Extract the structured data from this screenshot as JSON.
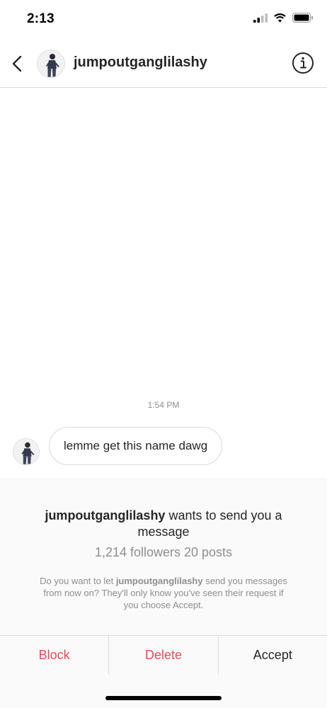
{
  "status_bar": {
    "time": "2:13",
    "icons": [
      "cellular-signal-icon",
      "wifi-icon",
      "battery-icon"
    ]
  },
  "nav": {
    "back_icon": "chevron-left-icon",
    "avatar": "profile-avatar",
    "username": "jumpoutganglilashy",
    "info_icon": "info-icon"
  },
  "chat": {
    "timestamp": "1:54 PM",
    "messages": [
      {
        "sender": "jumpoutganglilashy",
        "text": "lemme get this name dawg"
      }
    ]
  },
  "request": {
    "username": "jumpoutganglilashy",
    "title_suffix": " wants to send you a message",
    "stats": "1,214 followers 20 posts",
    "desc_prefix": "Do you want to let ",
    "desc_username": "jumpoutganglilashy",
    "desc_suffix": " send you messages from now on? They'll only know you've seen their request if you choose Accept."
  },
  "actions": {
    "block": "Block",
    "delete": "Delete",
    "accept": "Accept"
  },
  "colors": {
    "destructive": "#ed4956",
    "primary_text": "#262626",
    "secondary_text": "#8e8e8e",
    "divider": "#dbdbdb"
  }
}
